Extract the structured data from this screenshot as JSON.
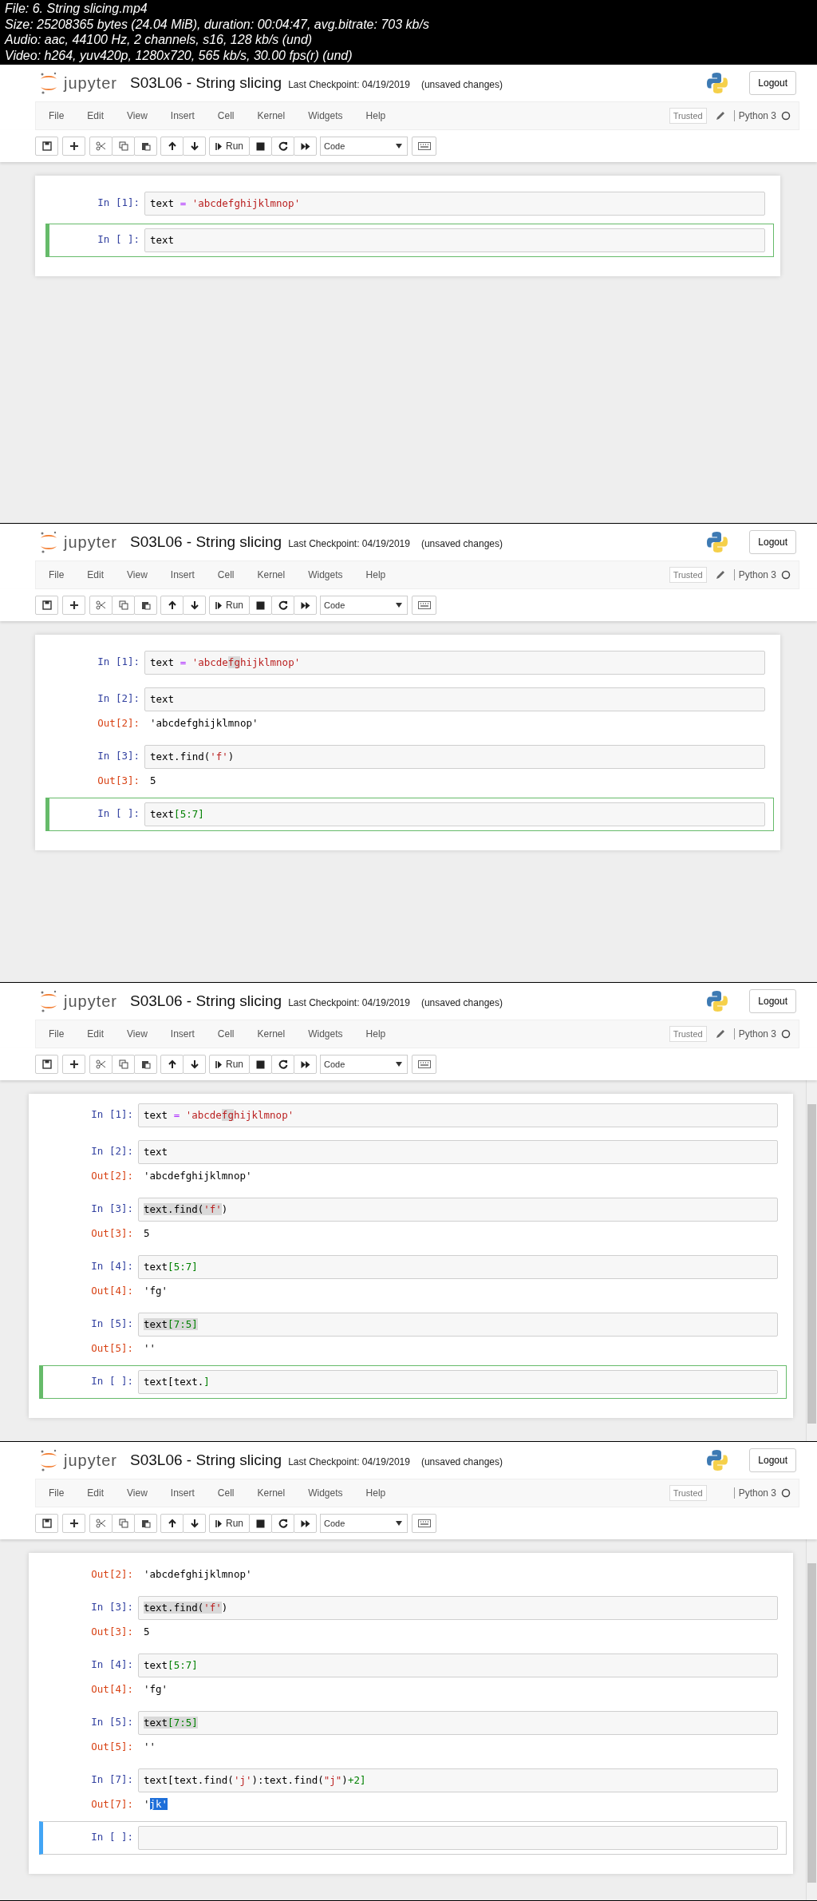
{
  "info_lines": [
    "File: 6. String slicing.mp4",
    "Size: 25208365 bytes (24.04 MiB), duration: 00:04:47, avg.bitrate: 703 kb/s",
    "Audio: aac, 44100 Hz, 2 channels, s16, 128 kb/s (und)",
    "Video: h264, yuv420p, 1280x720, 565 kb/s, 30.00 fps(r) (und)"
  ],
  "frames": [
    {
      "logo_text": "jupyter",
      "notebook_name": "S03L06 - String slicing",
      "checkpoint": "Last Checkpoint: 04/19/2019",
      "unsaved": "(unsaved changes)",
      "logout": "Logout",
      "menu": [
        "File",
        "Edit",
        "View",
        "Insert",
        "Cell",
        "Kernel",
        "Widgets",
        "Help"
      ],
      "trusted": "Trusted",
      "edit_icon": true,
      "kernel": "Python 3",
      "run_label": "Run",
      "cell_type": "Code",
      "scrollbar": false,
      "cells": [
        {
          "prompt": "In [1]:",
          "selected": false,
          "code": [
            {
              "t": "text ",
              "kind": "n",
              "hl": false
            },
            {
              "t": "=",
              "kind": "o",
              "hl": false
            },
            {
              "t": " 'abcdefghijklmnop'",
              "kind": "s",
              "hl": false
            }
          ]
        },
        {
          "prompt": "In [ ]:",
          "selected": true,
          "kind": "edit",
          "code": [
            {
              "t": "text",
              "kind": "n",
              "hl": false
            }
          ]
        }
      ]
    },
    {
      "logo_text": "jupyter",
      "notebook_name": "S03L06 - String slicing",
      "checkpoint": "Last Checkpoint: 04/19/2019",
      "unsaved": "(unsaved changes)",
      "logout": "Logout",
      "menu": [
        "File",
        "Edit",
        "View",
        "Insert",
        "Cell",
        "Kernel",
        "Widgets",
        "Help"
      ],
      "trusted": "Trusted",
      "edit_icon": true,
      "kernel": "Python 3",
      "run_label": "Run",
      "cell_type": "Code",
      "scrollbar": false,
      "cells": [
        {
          "prompt": "In [1]:",
          "selected": false,
          "code": [
            {
              "t": "text ",
              "kind": "n",
              "hl": false
            },
            {
              "t": "=",
              "kind": "o",
              "hl": false
            },
            {
              "t": " 'abcde",
              "kind": "s",
              "hl": false
            },
            {
              "t": "fg",
              "kind": "s",
              "hl": true
            },
            {
              "t": "hijklmnop'",
              "kind": "s",
              "hl": false
            }
          ]
        },
        {
          "prompt": "In [2]:",
          "selected": false,
          "code": [
            {
              "t": "text",
              "kind": "n",
              "hl": false
            }
          ],
          "out_prompt": "Out[2]:",
          "output": [
            {
              "t": "'abcdefghijklmnop'",
              "sel": false
            }
          ]
        },
        {
          "prompt": "In [3]:",
          "selected": false,
          "code": [
            {
              "t": "text.find(",
              "kind": "n",
              "hl": false
            },
            {
              "t": "'f'",
              "kind": "s",
              "hl": false
            },
            {
              "t": ")",
              "kind": "n",
              "hl": false
            }
          ],
          "out_prompt": "Out[3]:",
          "output": [
            {
              "t": "5",
              "sel": false
            }
          ]
        },
        {
          "prompt": "In [ ]:",
          "selected": true,
          "kind": "edit",
          "code": [
            {
              "t": "text",
              "kind": "n",
              "hl": false
            },
            {
              "t": "[5:7]",
              "kind": "g",
              "hl": false
            }
          ]
        }
      ]
    },
    {
      "logo_text": "jupyter",
      "notebook_name": "S03L06 - String slicing",
      "checkpoint": "Last Checkpoint: 04/19/2019",
      "unsaved": "(unsaved changes)",
      "logout": "Logout",
      "menu": [
        "File",
        "Edit",
        "View",
        "Insert",
        "Cell",
        "Kernel",
        "Widgets",
        "Help"
      ],
      "trusted": "Trusted",
      "edit_icon": true,
      "kernel": "Python 3",
      "run_label": "Run",
      "cell_type": "Code",
      "scrollbar": true,
      "cells": [
        {
          "prompt": "In [1]:",
          "selected": false,
          "code": [
            {
              "t": "text ",
              "kind": "n",
              "hl": false
            },
            {
              "t": "=",
              "kind": "o",
              "hl": false
            },
            {
              "t": " 'abcde",
              "kind": "s",
              "hl": false
            },
            {
              "t": "fg",
              "kind": "s",
              "hl": true
            },
            {
              "t": "hijklmnop'",
              "kind": "s",
              "hl": false
            }
          ]
        },
        {
          "prompt": "In [2]:",
          "selected": false,
          "code": [
            {
              "t": "text",
              "kind": "n",
              "hl": false
            }
          ],
          "out_prompt": "Out[2]:",
          "output": [
            {
              "t": "'abcdefghijklmnop'",
              "sel": false
            }
          ]
        },
        {
          "prompt": "In [3]:",
          "selected": false,
          "code": [
            {
              "t": "text.find(",
              "kind": "n",
              "hl": true
            },
            {
              "t": "'f'",
              "kind": "s",
              "hl": true
            },
            {
              "t": ")",
              "kind": "n",
              "hl": false
            }
          ],
          "out_prompt": "Out[3]:",
          "output": [
            {
              "t": "5",
              "sel": false
            }
          ]
        },
        {
          "prompt": "In [4]:",
          "selected": false,
          "code": [
            {
              "t": "text",
              "kind": "n",
              "hl": false
            },
            {
              "t": "[5:7]",
              "kind": "g",
              "hl": false
            }
          ],
          "out_prompt": "Out[4]:",
          "output": [
            {
              "t": "'fg'",
              "sel": false
            }
          ]
        },
        {
          "prompt": "In [5]:",
          "selected": false,
          "code": [
            {
              "t": "text",
              "kind": "n",
              "hl": true
            },
            {
              "t": "[7:5]",
              "kind": "g",
              "hl": true
            }
          ],
          "out_prompt": "Out[5]:",
          "output": [
            {
              "t": "''",
              "sel": false
            }
          ]
        },
        {
          "prompt": "In [ ]:",
          "selected": true,
          "kind": "edit",
          "code": [
            {
              "t": "text[text.",
              "kind": "n",
              "hl": false
            },
            {
              "t": "]",
              "kind": "g",
              "hl": false
            }
          ]
        }
      ]
    },
    {
      "logo_text": "jupyter",
      "notebook_name": "S03L06 - String slicing",
      "checkpoint": "Last Checkpoint: 04/19/2019",
      "unsaved": "(unsaved changes)",
      "logout": "Logout",
      "menu": [
        "File",
        "Edit",
        "View",
        "Insert",
        "Cell",
        "Kernel",
        "Widgets",
        "Help"
      ],
      "trusted": "Trusted",
      "edit_icon": false,
      "kernel": "Python 3",
      "run_label": "Run",
      "cell_type": "Code",
      "scrollbar": true,
      "cells": [
        {
          "selected": false,
          "out_prompt": "Out[2]:",
          "output": [
            {
              "t": "'abcdefghijklmnop'",
              "sel": false
            }
          ]
        },
        {
          "prompt": "In [3]:",
          "selected": false,
          "code": [
            {
              "t": "text.find(",
              "kind": "n",
              "hl": true
            },
            {
              "t": "'f'",
              "kind": "s",
              "hl": true
            },
            {
              "t": ")",
              "kind": "n",
              "hl": false
            }
          ],
          "out_prompt": "Out[3]:",
          "output": [
            {
              "t": "5",
              "sel": false
            }
          ]
        },
        {
          "prompt": "In [4]:",
          "selected": false,
          "code": [
            {
              "t": "text",
              "kind": "n",
              "hl": false
            },
            {
              "t": "[5:7]",
              "kind": "g",
              "hl": false
            }
          ],
          "out_prompt": "Out[4]:",
          "output": [
            {
              "t": "'fg'",
              "sel": false
            }
          ]
        },
        {
          "prompt": "In [5]:",
          "selected": false,
          "code": [
            {
              "t": "text",
              "kind": "n",
              "hl": true
            },
            {
              "t": "[7:5]",
              "kind": "g",
              "hl": true
            }
          ],
          "out_prompt": "Out[5]:",
          "output": [
            {
              "t": "''",
              "sel": false
            }
          ]
        },
        {
          "prompt": "In [7]:",
          "selected": false,
          "code": [
            {
              "t": "text[text.find(",
              "kind": "n",
              "hl": false
            },
            {
              "t": "'j'",
              "kind": "s",
              "hl": false
            },
            {
              "t": "):text.find(",
              "kind": "n",
              "hl": false
            },
            {
              "t": "\"j\"",
              "kind": "s",
              "hl": false
            },
            {
              "t": ")",
              "kind": "n",
              "hl": false
            },
            {
              "t": "+2]",
              "kind": "g",
              "hl": false
            }
          ],
          "out_prompt": "Out[7]:",
          "output": [
            {
              "t": "'",
              "sel": false
            },
            {
              "t": "jk'",
              "sel": true
            }
          ]
        },
        {
          "prompt": "In [ ]:",
          "selected": true,
          "kind": "command"
        }
      ]
    }
  ]
}
